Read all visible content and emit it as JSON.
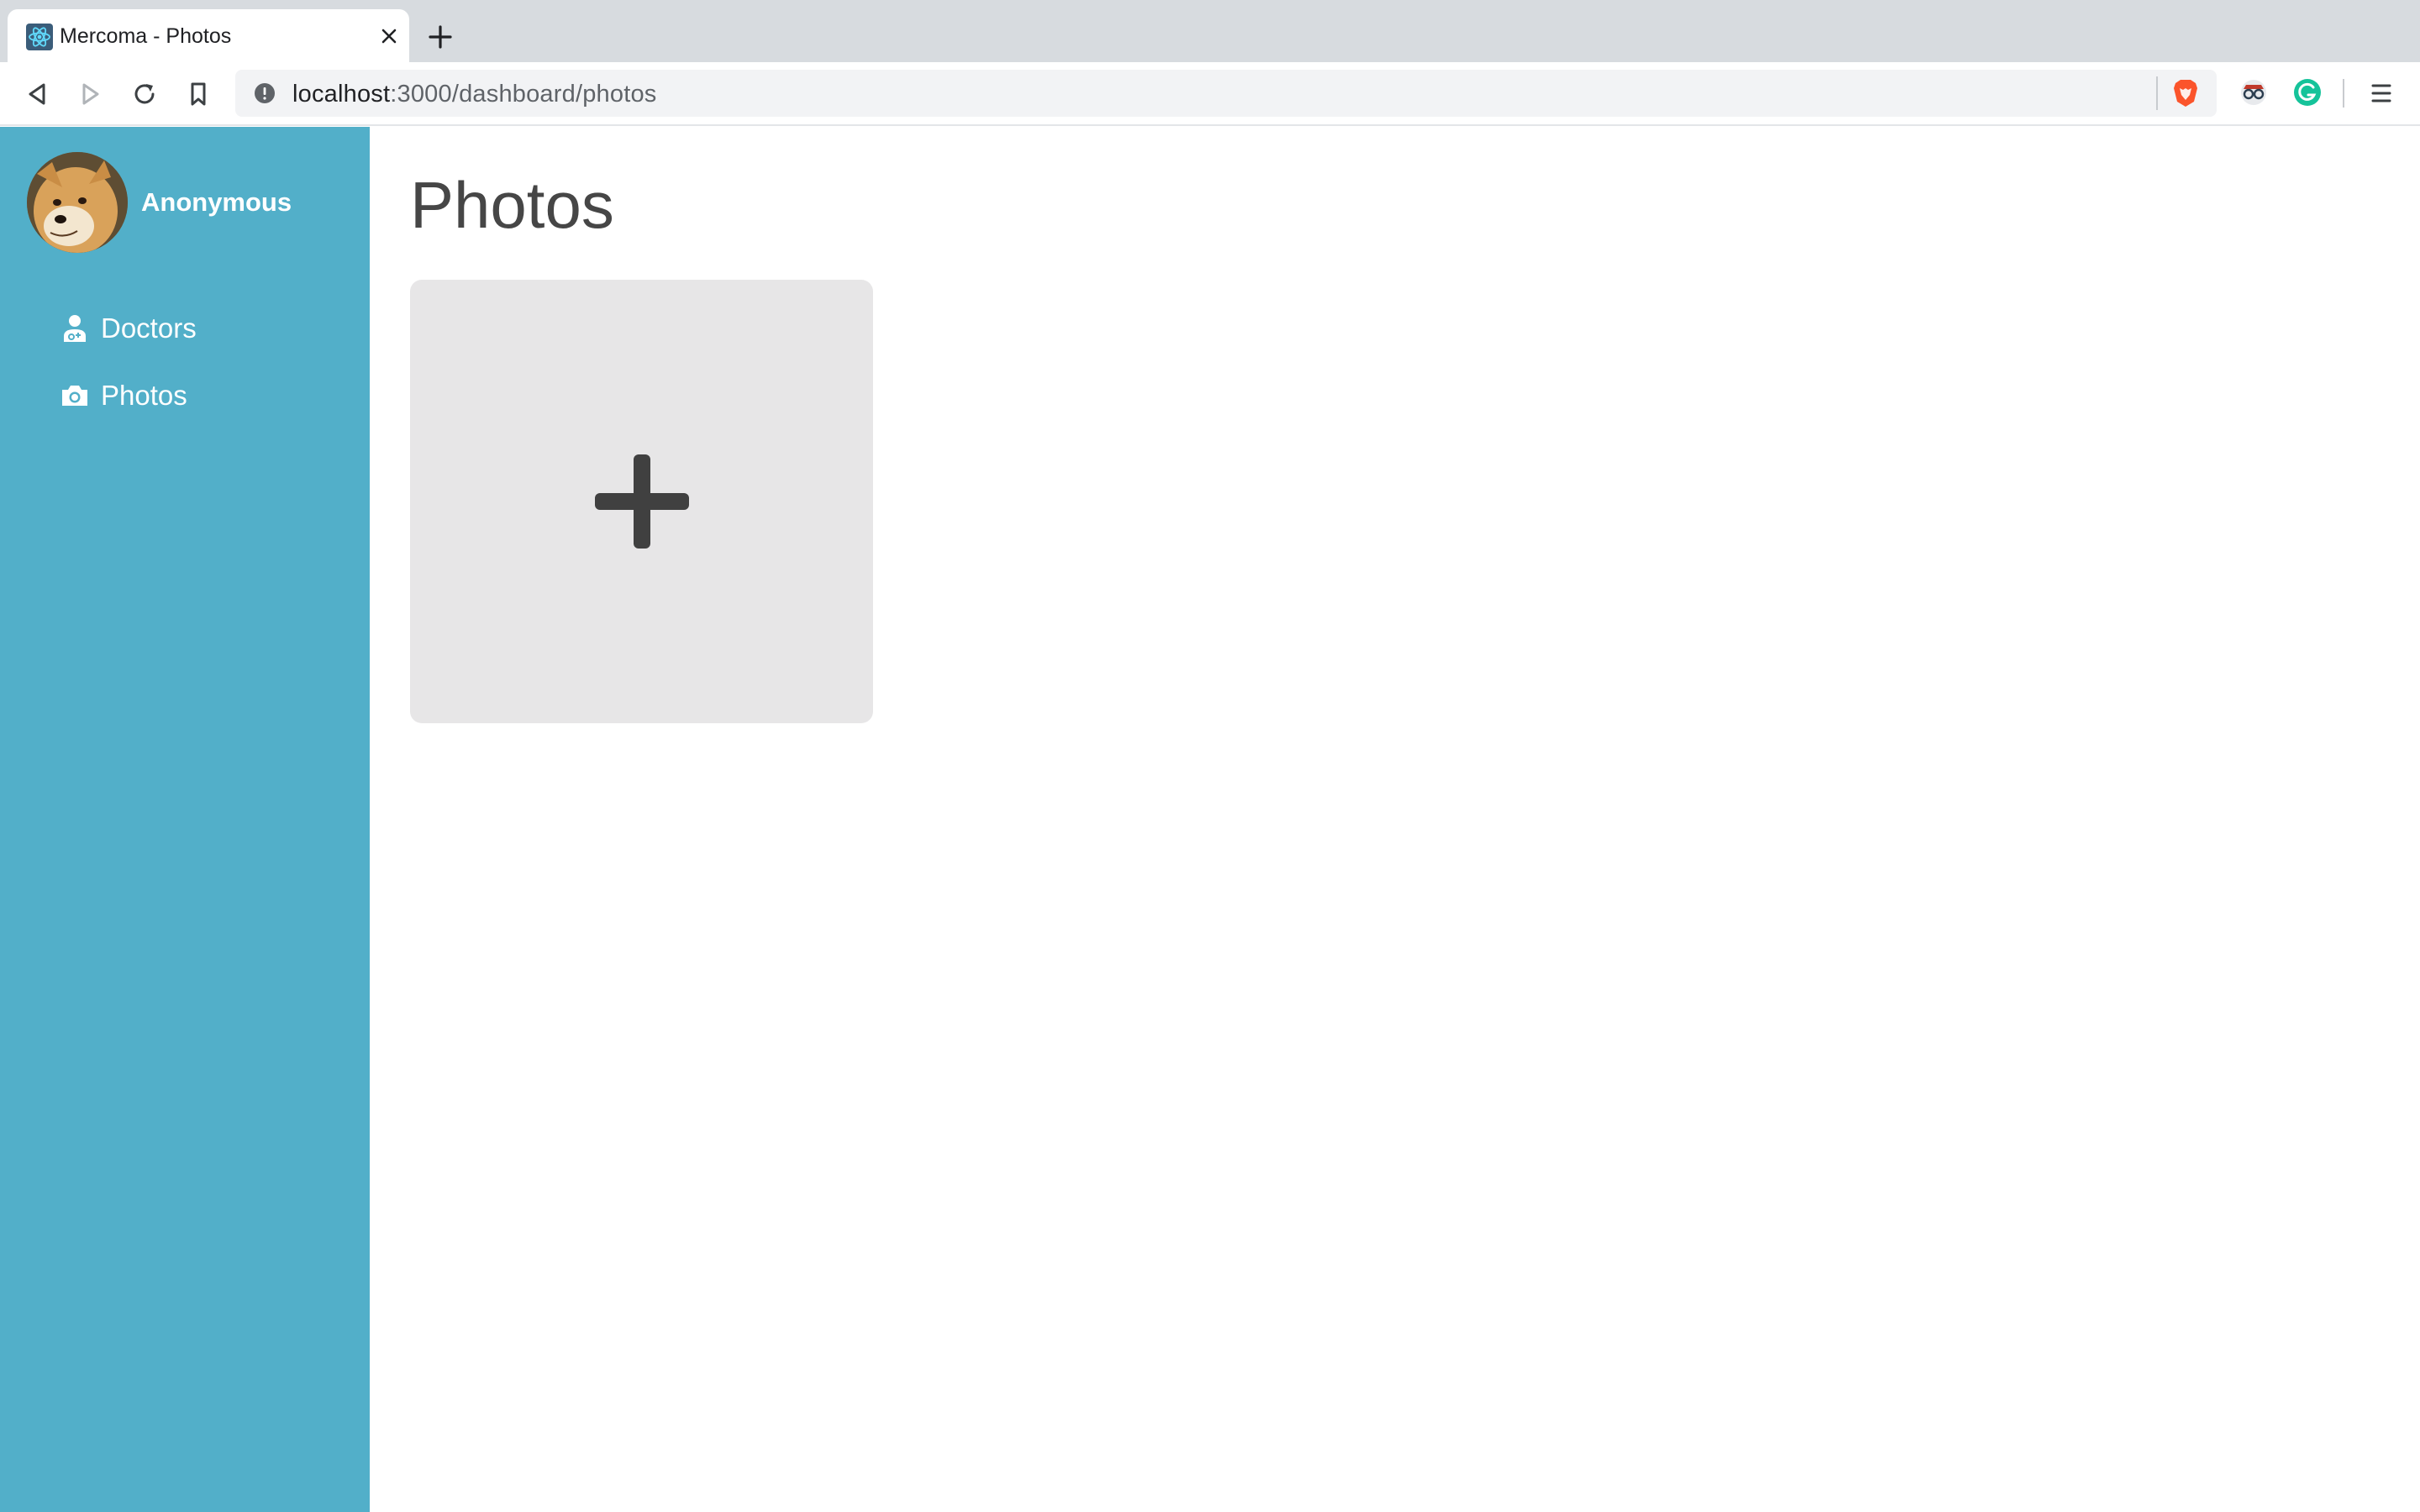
{
  "browser": {
    "tab": {
      "title": "Mercoma - Photos"
    },
    "url": {
      "host": "localhost",
      "path": ":3000/dashboard/photos"
    }
  },
  "icons": {
    "tab_favicon": "react-atom-icon",
    "tab_close": "close-icon",
    "new_tab": "plus-icon",
    "back": "back-icon",
    "forward": "forward-icon",
    "reload": "reload-icon",
    "bookmark": "bookmark-icon",
    "site_info": "info-icon",
    "brave_shields": "brave-lion-icon",
    "extension_1": "spy-extension-icon",
    "extension_2": "grammarly-icon",
    "menu": "hamburger-menu-icon",
    "doctors": "doctor-icon",
    "photos": "camera-icon",
    "add_photo": "plus-icon"
  },
  "colors": {
    "sidebar": "#52afc9",
    "card": "#e7e6e7",
    "title": "#464646",
    "grammarly": "#15c39a",
    "brave": "#fb542b"
  },
  "sidebar": {
    "user": {
      "name": "Anonymous"
    },
    "items": [
      {
        "label": "Doctors"
      },
      {
        "label": "Photos"
      }
    ]
  },
  "main": {
    "title": "Photos"
  }
}
